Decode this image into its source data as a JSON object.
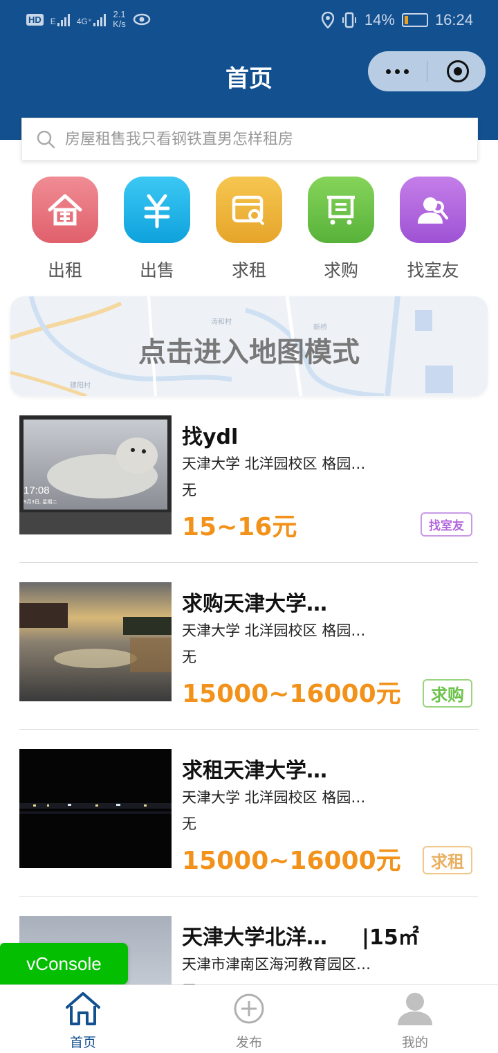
{
  "status_bar": {
    "hd": "HD",
    "network_1": "E",
    "network_2": "4G⁺",
    "speed_value": "2.1",
    "speed_unit": "K/s",
    "battery": "14%",
    "time": "16:24"
  },
  "header": {
    "title": "首页"
  },
  "search": {
    "placeholder": "房屋租售我只看钢铁直男怎样租房"
  },
  "categories": [
    {
      "label": "出租",
      "color": "#e8707a",
      "icon": "house-icon"
    },
    {
      "label": "出售",
      "color": "#1eb3e8",
      "icon": "yuan-icon"
    },
    {
      "label": "求租",
      "color": "#f0b53a",
      "icon": "wallet-search-icon"
    },
    {
      "label": "求购",
      "color": "#6cc24a",
      "icon": "cart-icon"
    },
    {
      "label": "找室友",
      "color": "#b266dc",
      "icon": "roommate-icon"
    }
  ],
  "map_banner": {
    "text": "点击进入地图模式",
    "map_labels": [
      "涛和村",
      "新桥",
      "建阳村"
    ]
  },
  "listings": [
    {
      "title": "找ydl",
      "location": "天津大学 北洋园校区 格园…",
      "desc": "无",
      "price": "15~16元",
      "tag": "找室友",
      "tag_color": "#b266dc",
      "photo_time": "17:08",
      "photo_date": "9月3日, 星期二"
    },
    {
      "title": "求购天津大学…",
      "location": "天津大学 北洋园校区 格园…",
      "desc": "无",
      "price": "15000~16000元",
      "tag": "求购",
      "tag_color": "#6cc24a"
    },
    {
      "title": "求租天津大学…",
      "location": "天津大学 北洋园校区 格园…",
      "desc": "无",
      "price": "15000~16000元",
      "tag": "求租",
      "tag_color": "#e8b060"
    },
    {
      "title": "天津大学北洋…",
      "area": "|15㎡",
      "location": "天津市津南区海河教育园区…",
      "desc": "无"
    }
  ],
  "vconsole": {
    "label": "vConsole"
  },
  "tabbar": [
    {
      "label": "首页",
      "icon": "home-icon",
      "active": true
    },
    {
      "label": "发布",
      "icon": "plus-circle-icon",
      "active": false
    },
    {
      "label": "我的",
      "icon": "user-icon",
      "active": false
    }
  ]
}
